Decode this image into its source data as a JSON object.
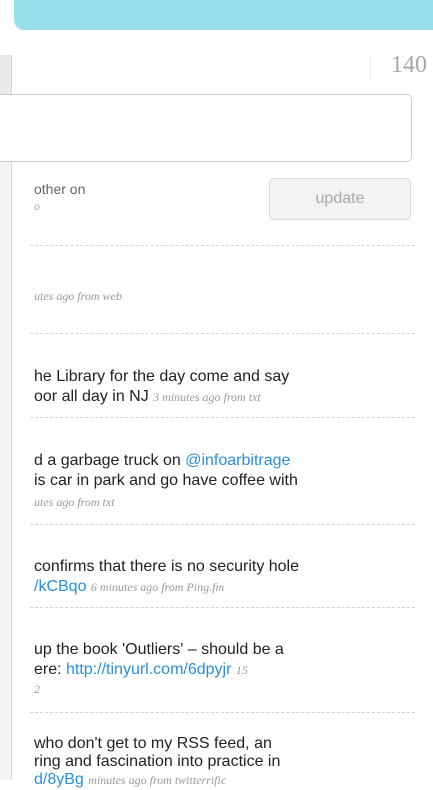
{
  "counter": "140",
  "status": {
    "placeholder": ""
  },
  "latest": {
    "text": "other on",
    "meta": "o"
  },
  "update_label": "update",
  "tweets": [
    {
      "meta": "utes ago from web"
    },
    {
      "line1": "he Library for the day come and say",
      "line2": "oor all day in NJ",
      "meta": "3 minutes ago from txt"
    },
    {
      "line1_pre": "d a garbage truck on ",
      "mention": "@infoarbitrage",
      "line2": "is car in park and go have coffee with",
      "meta": "utes ago from txt"
    },
    {
      "line1": "confirms that there is no security hole",
      "link": "/kCBqo",
      "meta": "6 minutes ago from Ping.fm"
    },
    {
      "line1": "up the book 'Outliers' – should be a",
      "line2_pre": "ere: ",
      "link": "http://tinyurl.com/6dpyjr",
      "meta": "15",
      "meta2": "2"
    },
    {
      "line1": "who don't get to my RSS feed, an",
      "line2": "ring and fascination into practice in",
      "link": "d/8yBg",
      "meta": "minutes ago from twitterrific"
    }
  ]
}
